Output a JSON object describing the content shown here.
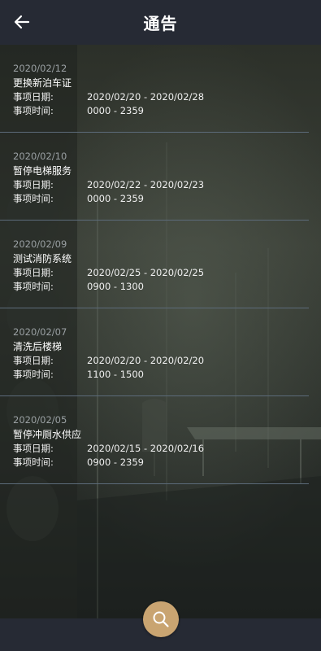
{
  "header": {
    "title": "通告",
    "back_icon": "arrow-left-icon"
  },
  "labels": {
    "date_label": "事项日期:",
    "time_label": "事项时间:"
  },
  "notices": [
    {
      "posted": "2020/02/12",
      "title": "更换新泊车证",
      "date_range": "2020/02/20 - 2020/02/28",
      "time_range": "0000 - 2359"
    },
    {
      "posted": "2020/02/10",
      "title": "暂停电梯服务",
      "date_range": "2020/02/22 - 2020/02/23",
      "time_range": "0000 - 2359"
    },
    {
      "posted": "2020/02/09",
      "title": "测试消防系统",
      "date_range": "2020/02/25 - 2020/02/25",
      "time_range": "0900 - 1300"
    },
    {
      "posted": "2020/02/07",
      "title": "清洗后楼梯",
      "date_range": "2020/02/20 - 2020/02/20",
      "time_range": "1100 - 1500"
    },
    {
      "posted": "2020/02/05",
      "title": "暂停冲厕水供应",
      "date_range": "2020/02/15 - 2020/02/16",
      "time_range": "0900 - 2359"
    }
  ],
  "fab": {
    "icon": "search-icon",
    "color": "#c9a471"
  },
  "colors": {
    "header_bg": "#262a34",
    "divider": "#5c6b7a",
    "date_text": "#9aa0a3"
  }
}
